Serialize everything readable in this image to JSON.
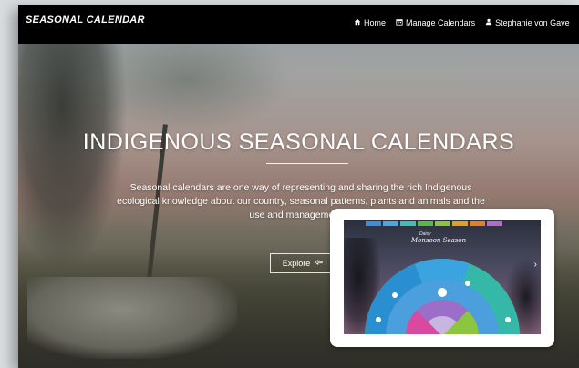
{
  "navbar": {
    "brand": "SEASONAL CALENDAR",
    "items": [
      {
        "label": "Home",
        "icon": "home-icon"
      },
      {
        "label": "Manage Calendars",
        "icon": "calendar-icon"
      },
      {
        "label": "Stephanie von Gave",
        "icon": "user-icon"
      }
    ]
  },
  "hero": {
    "title": "INDIGENOUS SEASONAL CALENDARS",
    "description": "Seasonal calendars are one way of representing and sharing the rich Indigenous ecological knowledge about our country, seasonal patterns, plants and animals and the use and management of",
    "explore_label": "Explore",
    "explore_icon": "hand-pointer-icon"
  },
  "preview": {
    "script_text": "Daisy",
    "season_title": "Monsoon Season",
    "tab_colors": [
      "#3a8fd8",
      "#4aa8e0",
      "#3fbfb0",
      "#58b848",
      "#8cc63e",
      "#e0a020",
      "#e67e22",
      "#b36bc7"
    ]
  },
  "colors": {
    "navbar_bg": "#000000",
    "text": "#ffffff"
  }
}
